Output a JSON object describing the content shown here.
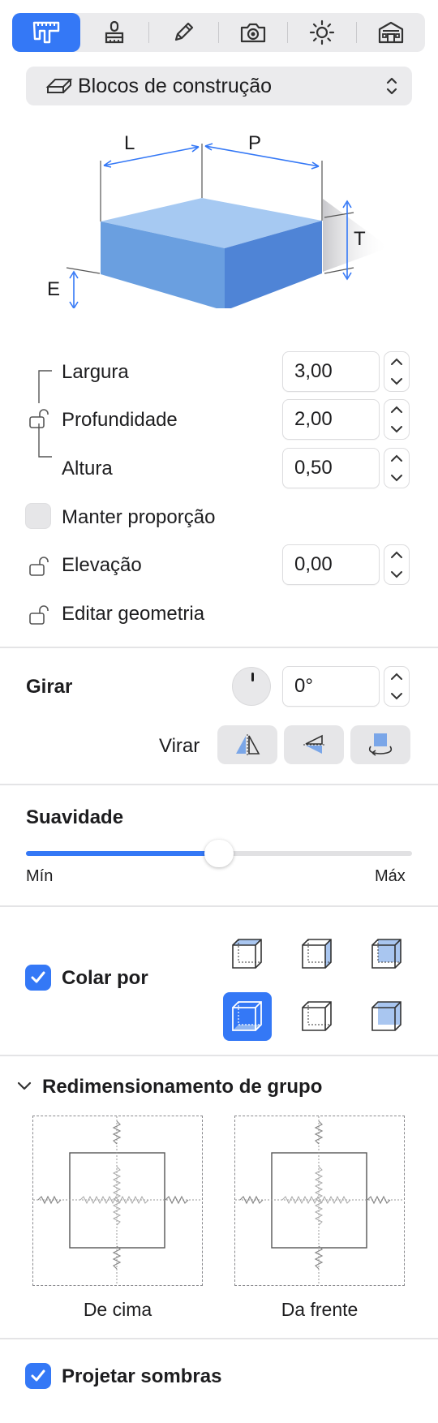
{
  "toolbar": {
    "tools": [
      {
        "icon": "caliper-icon",
        "active": true
      },
      {
        "icon": "paint-stamp-icon",
        "active": false
      },
      {
        "icon": "pencil-icon",
        "active": false
      },
      {
        "icon": "camera-icon",
        "active": false
      },
      {
        "icon": "sun-icon",
        "active": false
      },
      {
        "icon": "building-icon",
        "active": false
      }
    ]
  },
  "object_type": {
    "label": "Blocos de construção",
    "icon": "eraser-block-icon"
  },
  "diagram": {
    "labels": {
      "width": "L",
      "depth": "P",
      "height": "T",
      "elevation": "E"
    }
  },
  "dimensions": {
    "width": {
      "label": "Largura",
      "value": "3,00"
    },
    "depth": {
      "label": "Profundidade",
      "value": "2,00"
    },
    "height": {
      "label": "Altura",
      "value": "0,50"
    },
    "keep_ratio": {
      "label": "Manter proporção",
      "checked": false
    },
    "elevation": {
      "label": "Elevação",
      "value": "0,00"
    },
    "edit_geometry": {
      "label": "Editar geometria"
    }
  },
  "rotate": {
    "title": "Girar",
    "value": "0°",
    "flip_label": "Virar"
  },
  "smoothness": {
    "title": "Suavidade",
    "min_label": "Mín",
    "max_label": "Máx",
    "value_fraction": 0.5
  },
  "snap": {
    "label": "Colar por",
    "checked": true,
    "selected_index": 3
  },
  "group_resize": {
    "title": "Redimensionamento de grupo",
    "top_caption": "De cima",
    "front_caption": "Da frente"
  },
  "shadows": {
    "label": "Projetar sombras",
    "checked": true
  },
  "colors": {
    "accent": "#3478f6",
    "block_light": "#a6c9f2",
    "block_mid": "#6a9fe0",
    "block_dark": "#4f84d6"
  }
}
